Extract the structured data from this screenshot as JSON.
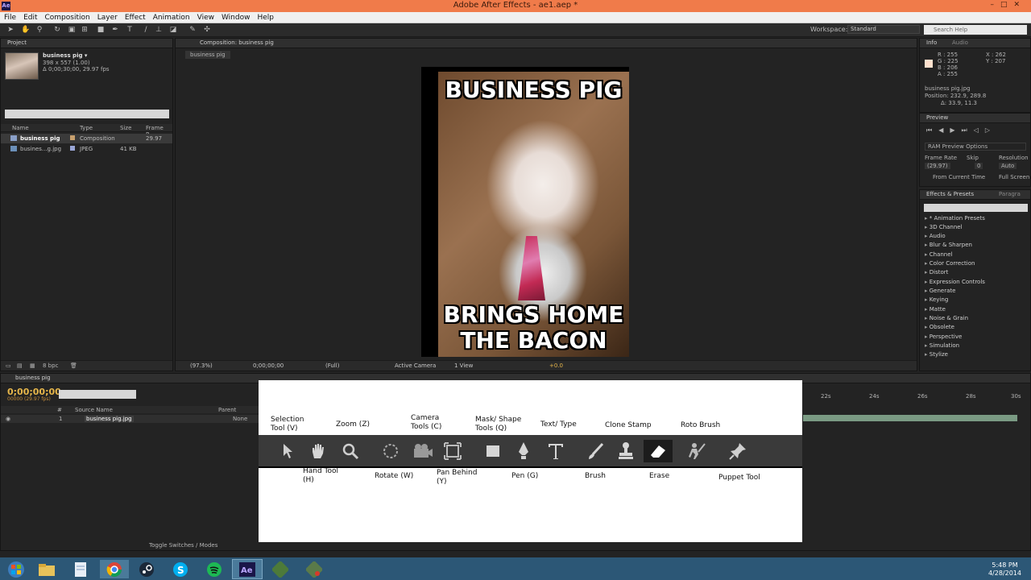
{
  "window": {
    "title": "Adobe After Effects - ae1.aep *",
    "app_icon": "Ae"
  },
  "menu": [
    "File",
    "Edit",
    "Composition",
    "Layer",
    "Effect",
    "Animation",
    "View",
    "Window",
    "Help"
  ],
  "toolbar": {
    "workspace_label": "Workspace:",
    "workspace_value": "Standard",
    "search_placeholder": "Search Help"
  },
  "project": {
    "tab": "Project",
    "item_name": "business pig ▾",
    "item_info1": "398 x 557 (1.00)",
    "item_info2": "Δ 0;00;30;00, 29.97 fps",
    "columns": {
      "name": "Name",
      "type": "Type",
      "size": "Size",
      "frame": "Frame R..."
    },
    "rows": [
      {
        "name": "business pig",
        "type": "Composition",
        "size": "",
        "frame": "29.97"
      },
      {
        "name": "busines...g.jpg",
        "type": "JPEG",
        "size": "41 KB",
        "frame": ""
      }
    ],
    "bpc": "8 bpc"
  },
  "comp": {
    "tab": "Composition: business pig",
    "subtab": "business pig",
    "meme_top": "BUSINESS PIG",
    "meme_bottom_1": "BRINGS HOME",
    "meme_bottom_2": "THE BACON",
    "footer": {
      "zoom": "(97.3%)",
      "time": "0;00;00;00",
      "res": "(Full)",
      "camera": "Active Camera",
      "view": "1 View",
      "offset": "+0.0"
    }
  },
  "info": {
    "tab": "Info",
    "tab2": "Audio",
    "r": "R : 255",
    "g": "G : 225",
    "b": "B : 206",
    "a": "A : 255",
    "x": "X : 262",
    "y": "Y : 207",
    "file": "business pig.jpg",
    "position": "Position: 232.9, 289.8",
    "delta": "Δ: 33.9, 11.3"
  },
  "preview": {
    "tab": "Preview",
    "ram": "RAM Preview Options",
    "frame_rate": "Frame Rate",
    "skip": "Skip",
    "resolution": "Resolution",
    "fr_value": "(29.97)",
    "skip_value": "0",
    "res_value": "Auto",
    "from_current": "From Current Time",
    "full_screen": "Full Screen"
  },
  "effects": {
    "tab": "Effects & Presets",
    "tab2": "Paragra",
    "items": [
      "* Animation Presets",
      "3D Channel",
      "Audio",
      "Blur & Sharpen",
      "Channel",
      "Color Correction",
      "Distort",
      "Expression Controls",
      "Generate",
      "Keying",
      "Matte",
      "Noise & Grain",
      "Obsolete",
      "Perspective",
      "Simulation",
      "Stylize"
    ]
  },
  "timeline": {
    "tab": "business pig",
    "timecode": "0;00;00;00",
    "timecode_sub": "00000 (29.97 fps)",
    "col_source": "Source Name",
    "col_parent": "Parent",
    "layer_num": "1",
    "layer_name": "business pig.jpg",
    "layer_parent": "None",
    "ruler": [
      "22s",
      "24s",
      "26s",
      "28s",
      "30s"
    ],
    "toggle": "Toggle Switches / Modes"
  },
  "overlay": {
    "top_labels": [
      "Selection\nTool (V)",
      "Zoom (Z)",
      "Camera\nTools (C)",
      "Mask/ Shape\nTools (Q)",
      "Text/ Type",
      "Clone Stamp",
      "Roto Brush"
    ],
    "bottom_labels": [
      "Hand Tool\n(H)",
      "Rotate (W)",
      "Pan Behind\n(Y)",
      "Pen (G)",
      "Brush",
      "Erase",
      "Puppet Tool"
    ]
  },
  "clock": {
    "time": "5:48 PM",
    "date": "4/28/2014"
  },
  "colors": {
    "title_bar": "#f07b4a",
    "taskbar": "#2c5776",
    "timecode": "#e6b64a",
    "layer_bar": "#7a9a83"
  }
}
